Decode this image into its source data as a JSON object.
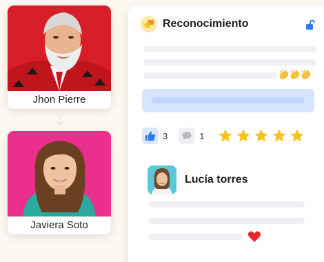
{
  "people": [
    {
      "name": "Jhon Pierre"
    },
    {
      "name": "Javiera Soto"
    }
  ],
  "recognition_card": {
    "title": "Reconocimiento",
    "icons": {
      "badge": "star-badge-icon",
      "lock": "unlock-icon",
      "claps": "clapping-hands-icon"
    },
    "likes": {
      "count": "3",
      "icon": "thumbs-up-icon"
    },
    "comments": {
      "count": "1",
      "icon": "speech-bubble-icon"
    },
    "rating": {
      "value": 5,
      "max": 5
    },
    "comment": {
      "author": "Lucía torres",
      "icon": "heart-icon"
    }
  },
  "colors": {
    "accent_blue": "#2f7de6",
    "star": "#f7c21b",
    "heart": "#e8262c"
  }
}
